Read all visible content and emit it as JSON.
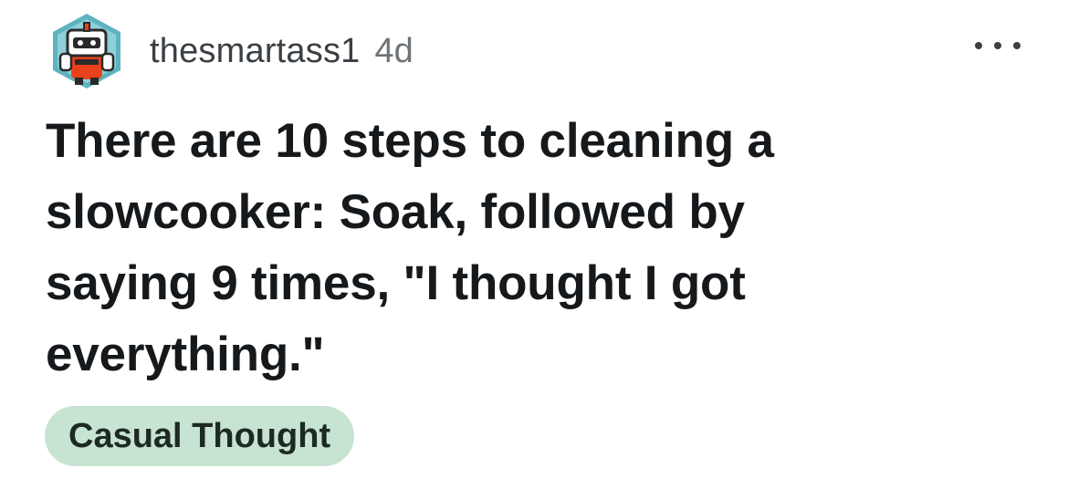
{
  "post": {
    "username": "thesmartass1",
    "age": "4d",
    "more_icon": "more-horizontal-icon",
    "title_lines": [
      "There are 10 steps to cleaning a",
      "slowcooker: Soak, followed by",
      "saying 9 times, \"I thought I got",
      "everything.\""
    ],
    "flair": "Casual Thought"
  },
  "colors": {
    "flair_background": "#c7e3d1",
    "avatar_hex": "#5fb3c0",
    "avatar_accent": "#e8411c"
  }
}
